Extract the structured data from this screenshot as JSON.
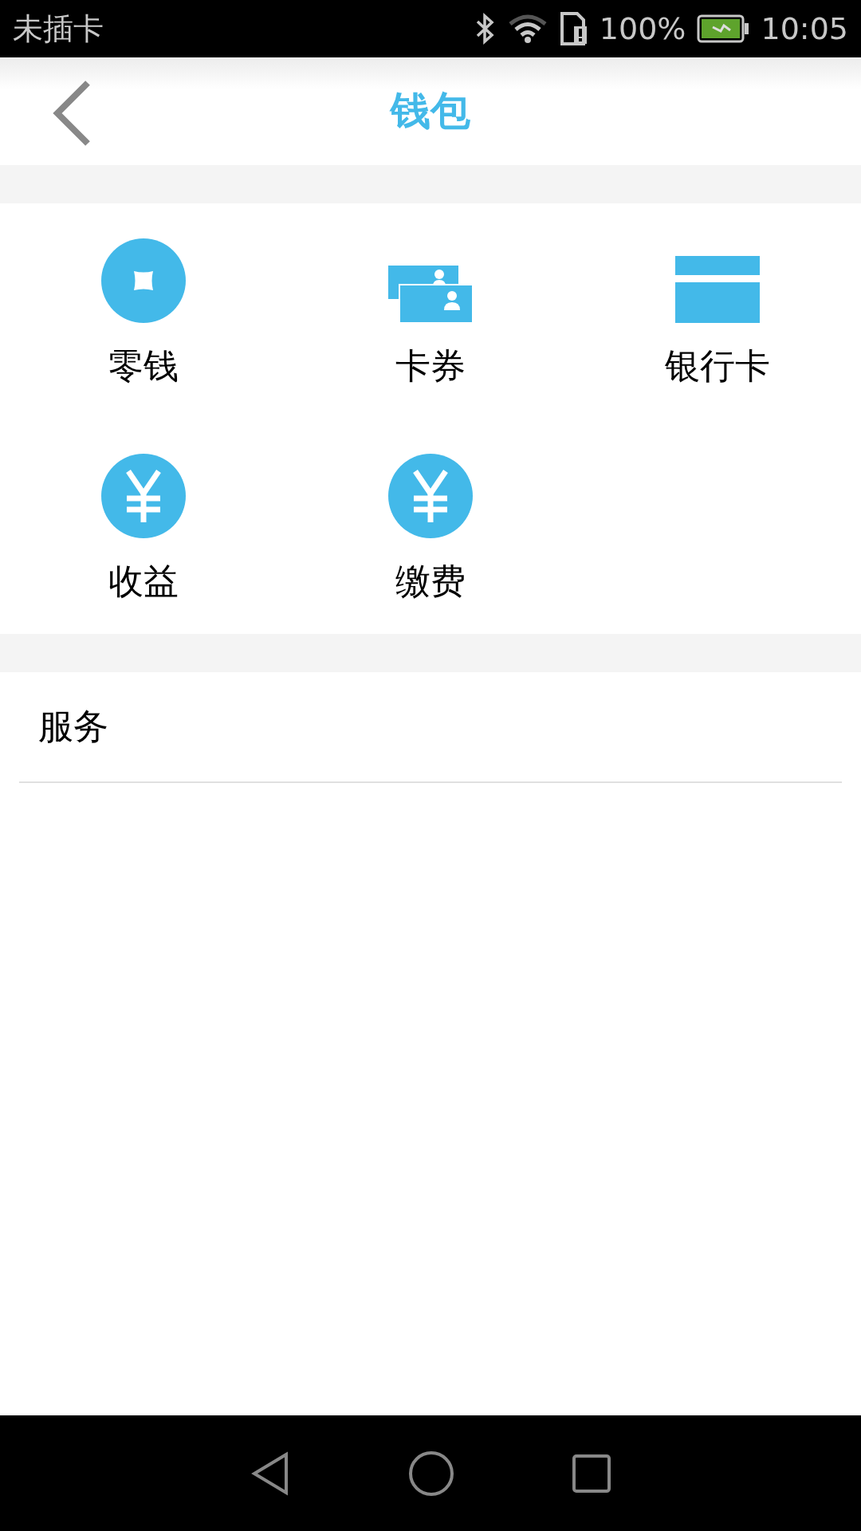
{
  "status_bar": {
    "carrier": "未插卡",
    "battery": "100%",
    "time": "10:05"
  },
  "header": {
    "title": "钱包"
  },
  "wallet_items": [
    {
      "label": "零钱",
      "kind": "coin"
    },
    {
      "label": "卡券",
      "kind": "cards"
    },
    {
      "label": "银行卡",
      "kind": "bank-card"
    },
    {
      "label": "收益",
      "kind": "yen"
    },
    {
      "label": "缴费",
      "kind": "yen"
    }
  ],
  "services": {
    "title": "服务"
  }
}
